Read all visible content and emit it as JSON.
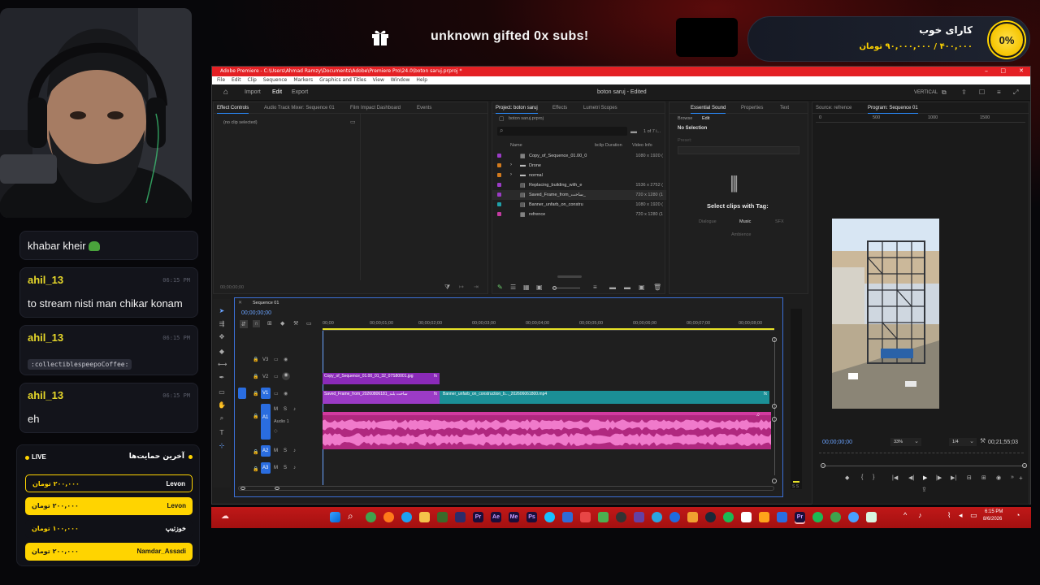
{
  "stream": {
    "alert_text": "unknown gifted 0x subs!",
    "goal": {
      "title": "کارای خوب",
      "amount": "۴۰۰,۰۰۰ / ۹۰,۰۰۰,۰۰۰ تومان",
      "percent": "0%"
    }
  },
  "chat": {
    "messages": [
      {
        "user": "",
        "time": "",
        "text": "khabar kheir"
      },
      {
        "user": "ahil_13",
        "time": "06:15 PM",
        "text": "to stream nisti man chikar konam"
      },
      {
        "user": "ahil_13",
        "time": "06:15 PM",
        "text": ":collectiblespeepoCoffee:"
      },
      {
        "user": "ahil_13",
        "time": "06:15 PM",
        "text": "eh"
      }
    ]
  },
  "donations": {
    "live_label": "LIVE",
    "title": "آخرین حمایت‌ها",
    "rows": [
      {
        "name": "Levon",
        "amount": "۲۰۰,۰۰۰ تومان",
        "style": "outline"
      },
      {
        "name": "Levon",
        "amount": "۲۰۰,۰۰۰ تومان",
        "style": "yellow"
      },
      {
        "name": "خوزتیپ",
        "amount": "۱۰۰,۰۰۰ تومان",
        "style": "dark"
      },
      {
        "name": "Namdar_Assadi",
        "amount": "۲۰۰,۰۰۰ تومان",
        "style": "yellow"
      }
    ]
  },
  "premiere": {
    "title": "Adobe Premiere - C:\\Users\\Ahmad Ramzy\\Documents\\Adobe\\Premiere Pro\\24.0\\boton saruj.prproj *",
    "menu": [
      "File",
      "Edit",
      "Clip",
      "Sequence",
      "Markers",
      "Graphics and Titles",
      "View",
      "Window",
      "Help"
    ],
    "workspace_tabs": [
      "Import",
      "Edit",
      "Export"
    ],
    "project_title": "boton saruj - Edited",
    "workspace_label": "VERTICAL",
    "effect_controls": {
      "tabs": [
        "Effect Controls",
        "Audio Track Mixer: Sequence 01",
        "Film Impact Dashboard",
        "Events"
      ],
      "no_clip": "(no clip selected)",
      "timecode": "00;00;00;00"
    },
    "project": {
      "tabs": [
        "Project: boton saruj",
        "Effects",
        "Lumetri Scopes"
      ],
      "file": "boton saruj.prproj",
      "count": "1 of 7 i...",
      "columns": [
        "Name",
        "bclip Duration",
        "Video Info"
      ],
      "items": [
        {
          "name": "Copy_of_Sequence_01.00_0",
          "info": "1080 x 1920 (",
          "color": "#9b3bc6",
          "kind": "seq"
        },
        {
          "name": "Drone",
          "info": "",
          "color": "#d17a1d",
          "kind": "folder"
        },
        {
          "name": "normal",
          "info": "",
          "color": "#d17a1d",
          "kind": "folder"
        },
        {
          "name": "Replacing_building_with_e",
          "info": "1536 x 2752 (",
          "color": "#9b3bc6",
          "kind": "clip"
        },
        {
          "name": "Saved_Frame_from_ساخت_",
          "info": "720 x 1280 (1",
          "color": "#9b3bc6",
          "kind": "clip"
        },
        {
          "name": "Banner_unfarb_on_constru",
          "info": "1080 x 1920 (",
          "color": "#1fa0a8",
          "kind": "clip"
        },
        {
          "name": "refrence",
          "info": "720 x 1280 (1",
          "color": "#c23aa0",
          "kind": "seq"
        }
      ]
    },
    "essential_sound": {
      "tabs": [
        "Essential Sound",
        "Properties",
        "Text"
      ],
      "subtabs": [
        "Browse",
        "Edit"
      ],
      "no_selection": "No Selection",
      "preset": "Preset:",
      "select_label": "Select clips with Tag:",
      "tags": [
        "Dialogue",
        "Music",
        "SFX",
        "Ambience"
      ]
    },
    "monitor": {
      "tabs": [
        "Source: refrence",
        "Program: Sequence 01"
      ],
      "ruler": [
        "0",
        "500",
        "1000",
        "1500"
      ],
      "timecode": "00;00;00;00",
      "zoom": "33%",
      "quality": "1/4",
      "duration": "00;21;55;03"
    },
    "timeline": {
      "tab": "Sequence 01",
      "timecode": "00;00;00;00",
      "ruler": [
        "00;00",
        "00;00;01;00",
        "00;00;02;00",
        "00;00;03;00",
        "00;00;04;00",
        "00;00;05;00",
        "00;00;06;00",
        "00;00;07;00",
        "00;00;08;00"
      ],
      "tracks": [
        "V3",
        "V2",
        "V1",
        "A1",
        "A2",
        "A3"
      ],
      "audio_track_name": "Audio 1",
      "clips": [
        {
          "label": "Copy_of_Sequence_01.00_01_32_07S80001.jpg",
          "track": "V2"
        },
        {
          "label": "Saved_Frame_from_20260806181_ساخت بلند",
          "track": "V1"
        },
        {
          "label": "Banner_unfarb_on_construction_b..._202606061800.mp4",
          "track": "V1"
        }
      ]
    }
  },
  "taskbar": {
    "time": "6:15 PM",
    "date": "8/6/2026"
  }
}
